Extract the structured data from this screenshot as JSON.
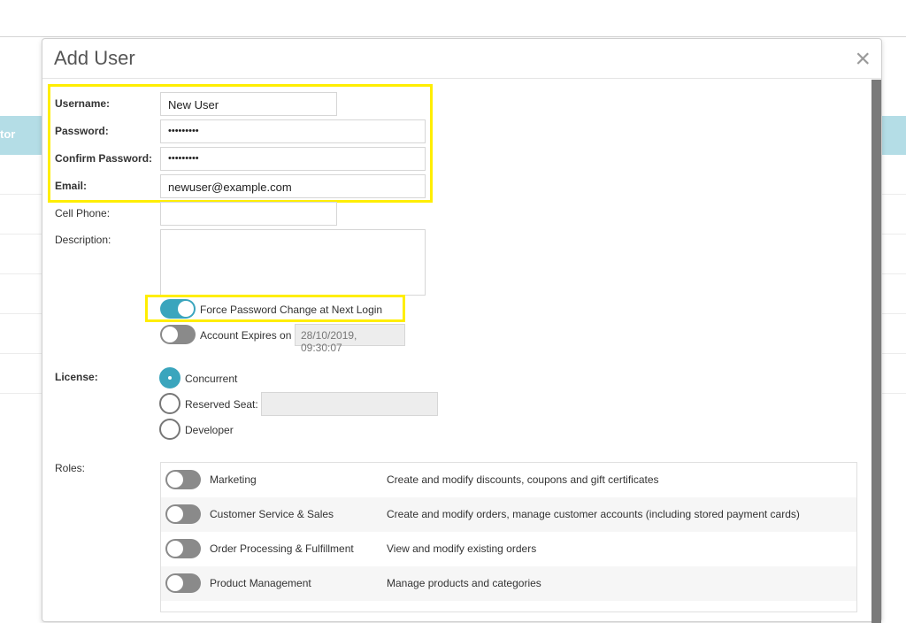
{
  "background": {
    "header_text": "tor"
  },
  "modal": {
    "title": "Add User",
    "close_symbol": "×"
  },
  "form": {
    "username": {
      "label": "Username:",
      "value": "New User"
    },
    "password": {
      "label": "Password:",
      "value": "•••••••••"
    },
    "confirm_password": {
      "label": "Confirm Password:",
      "value": "•••••••••"
    },
    "email": {
      "label": "Email:",
      "value": "newuser@example.com"
    },
    "cell_phone": {
      "label": "Cell Phone:",
      "value": ""
    },
    "description": {
      "label": "Description:",
      "value": ""
    },
    "force_password_change": {
      "label": "Force Password Change at Next Login",
      "checked": true
    },
    "account_expires": {
      "label": "Account Expires on",
      "checked": false,
      "date": "28/10/2019, 09:30:07"
    },
    "license": {
      "label": "License:",
      "options": [
        {
          "label": "Concurrent",
          "selected": true
        },
        {
          "label": "Reserved Seat:",
          "selected": false
        },
        {
          "label": "Developer",
          "selected": false
        }
      ]
    },
    "roles": {
      "label": "Roles:",
      "items": [
        {
          "name": "Marketing",
          "description": "Create and modify discounts, coupons and gift certificates",
          "enabled": false
        },
        {
          "name": "Customer Service & Sales",
          "description": "Create and modify orders, manage customer accounts (including stored payment cards)",
          "enabled": false
        },
        {
          "name": "Order Processing & Fulfillment",
          "description": "View and modify existing orders",
          "enabled": false
        },
        {
          "name": "Product Management",
          "description": "Manage products and categories",
          "enabled": false
        }
      ]
    }
  },
  "colors": {
    "accent": "#3aa5bd",
    "highlight": "#ffee00",
    "toggle_off": "#8a8a8a",
    "table_header": "#b4dde6"
  }
}
